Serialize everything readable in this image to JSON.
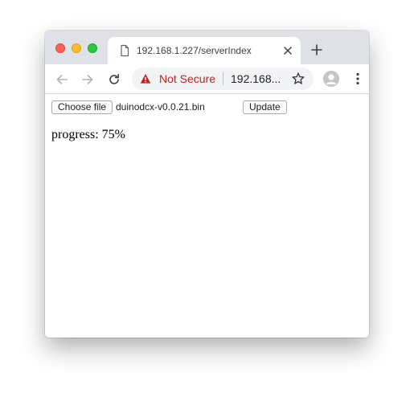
{
  "tab": {
    "title": "192.168.1.227/serverIndex"
  },
  "omnibox": {
    "security_label": "Not Secure",
    "url": "192.168..."
  },
  "form": {
    "choose_file_label": "Choose file",
    "file_name": "duinodcx-v0.0.21.bin",
    "update_label": "Update"
  },
  "status": {
    "progress_text": "progress: 75%"
  },
  "icons": {
    "tab_favicon": "document-icon",
    "tab_close": "close-icon",
    "new_tab": "plus-icon",
    "back": "arrow-left-icon",
    "forward": "arrow-right-icon",
    "reload": "reload-icon",
    "security": "warning-triangle-icon",
    "bookmark": "star-icon",
    "profile": "avatar-icon",
    "menu": "kebab-menu-icon"
  },
  "colors": {
    "tabstrip": "#dee1e6",
    "omnibox": "#f1f3f4",
    "not_secure": "#c5221f"
  }
}
